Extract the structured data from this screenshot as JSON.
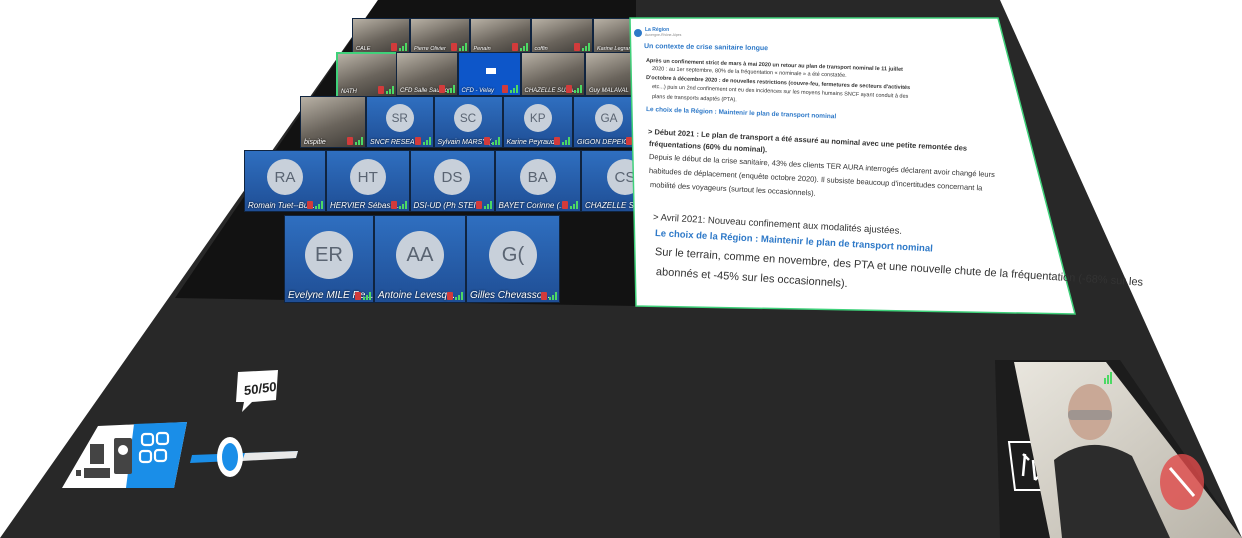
{
  "video_grid": {
    "row1": [
      {
        "name": "CALE",
        "type": "photo"
      },
      {
        "name": "Pierre Olivier",
        "type": "photo"
      },
      {
        "name": "Penain",
        "type": "photo"
      },
      {
        "name": "coffin",
        "type": "photo"
      },
      {
        "name": "Karine Legrand -",
        "type": "photo"
      }
    ],
    "row2": [
      {
        "name": "NATH",
        "type": "photo-active"
      },
      {
        "name": "CFD Salle Saumon",
        "type": "photo"
      },
      {
        "name": "CFD - Velay",
        "type": "logo"
      },
      {
        "name": "CHAZELLE SUZA...",
        "type": "photo"
      },
      {
        "name": "Guy MALAVAL",
        "type": "photo"
      }
    ],
    "row3": [
      {
        "name": "bispitie",
        "type": "photo"
      },
      {
        "initials": "SR",
        "name": "SNCF RESEAU"
      },
      {
        "initials": "SC",
        "name": "Sylvain MARSY (..."
      },
      {
        "initials": "KP",
        "name": "Karine Peyraud"
      },
      {
        "initials": "GA",
        "name": "GIGON DEPEIGE..."
      }
    ],
    "row4": [
      {
        "initials": "RA",
        "name": "Romain Tuet--Bu..."
      },
      {
        "initials": "HT",
        "name": "HERVIER Sébast..."
      },
      {
        "initials": "DS",
        "name": "DSI-UD (Ph STEI..."
      },
      {
        "initials": "BA",
        "name": "BAYET Corinne (..."
      },
      {
        "initials": "CS",
        "name": "CHAZELLE Suza..."
      }
    ],
    "row5": [
      {
        "initials": "ER",
        "name": "Evelyne MILE Re..."
      },
      {
        "initials": "AA",
        "name": "Antoine Levesq..."
      },
      {
        "initials": "G(",
        "name": "Gilles Chevasso..."
      }
    ]
  },
  "slide": {
    "logo_title": "La Région",
    "logo_subtitle": "Auvergne-Rhône-Alpes",
    "heading": "Un contexte de crise sanitaire longue",
    "bullet1_a": "Après un confinement strict de mars à mai 2020 un retour au plan de transport nominal le 11 juillet",
    "bullet1_b": "2020 : au 1er septembre, 80% de la fréquentation « nominale » a été constatée.",
    "bullet2_a": "D'octobre à décembre 2020 : de nouvelles restrictions (couvre-feu, fermetures de secteurs d'activités",
    "bullet2_b": "etc...) puis un 2nd confinement ont eu des incidences sur les moyens humains SNCF ayant conduit à des",
    "bullet2_c": "plans de transports adaptés (PTA).",
    "choice1": "Le choix de la Région : Maintenir le plan de transport nominal",
    "section2_a": "> Début 2021 : Le plan de transport a été assuré au nominal avec une petite remontée des",
    "section2_b": "fréquentations (60% du nominal).",
    "section2_c": "Depuis le début de la crise sanitaire, 43% des clients TER AURA interrogés déclarent avoir changé leurs",
    "section2_d": "habitudes de déplacement (enquête octobre 2020). Il subsiste beaucoup d'incertitudes concernant la",
    "section2_e": "mobilité des voyageurs (surtout les occasionnels).",
    "section3_a": "> Avril 2021: Nouveau confinement aux modalités ajustées.",
    "choice2": "Le choix de la Région : Maintenir le plan de transport nominal",
    "section3_b": "Sur le terrain, comme en novembre, des PTA et une nouvelle chute de la fréquentation (-68% sur les",
    "section3_c": "abonnés et -45% sur les occasionnels)."
  },
  "controls": {
    "ratio_label": "50/50",
    "split_ratio": 0.5
  },
  "colors": {
    "tile_blue": "#2f6fc0",
    "slide_blue": "#2e79c8",
    "accent_green": "#3fd17a",
    "control_blue": "#1a8ee8",
    "background_dark": "#292929"
  }
}
